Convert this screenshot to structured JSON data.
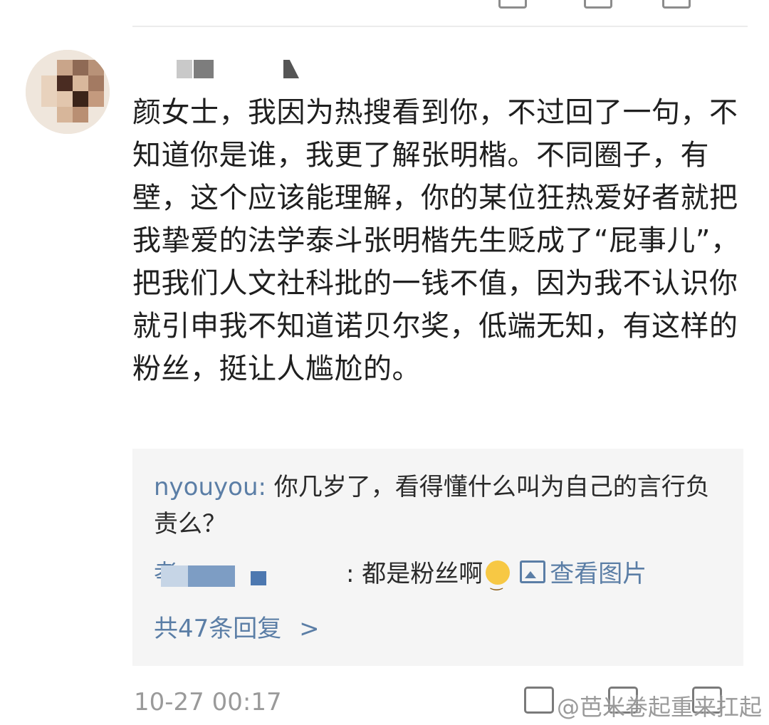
{
  "comment": {
    "text": "颜女士，我因为热搜看到你，不过回了一句，不知道你是谁，我更了解张明楷。不同圈子，有壁，这个应该能理解，你的某位狂热爱好者就把我挚爱的法学泰斗张明楷先生贬成了“屁事儿”，把我们人文社科批的一钱不值，因为我不认识你就引申我不知道诺贝尔奖，低端无知，有这样的粉丝，挺让人尴尬的。",
    "time": "10-27 00:17"
  },
  "replies": {
    "items": [
      {
        "name": "nyouyou",
        "separator": ":",
        "text": "你几岁了，看得懂什么叫为自己的言行负责么？"
      },
      {
        "name_visible_char": "孝",
        "separator": ":",
        "text": "都是粉丝啊",
        "view_pic_label": "查看图片"
      }
    ],
    "more_label": "共47条回复",
    "chevron": ">"
  },
  "watermark": "@芭米卷起重来扛起刀",
  "colors": {
    "link": "#5b7ea6",
    "text": "#1f1f1f",
    "meta": "#9a9a9a",
    "reply_bg": "#f5f5f5"
  }
}
